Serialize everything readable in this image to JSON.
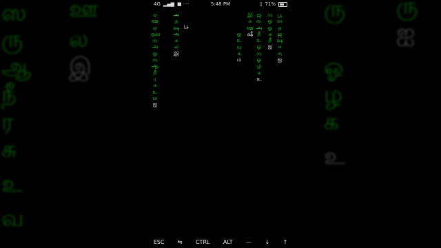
{
  "status_bar": {
    "network": "4G",
    "time": "5:48 PM",
    "battery": "71%",
    "battery_level": 0.71
  },
  "matrix_columns": [
    {
      "glyphs": [
        "ஏ",
        "ஊ",
        "ஏ",
        "ஔ",
        "ரு",
        "அ",
        "ஓ",
        "ரு",
        "ஆ",
        "நீ",
        "ர",
        "சு",
        "உ",
        "ள",
        "ஐ"
      ],
      "head_index": 14
    },
    {
      "glyphs": [
        "அ",
        "த",
        "ஷ",
        "அ",
        "க",
        "ல",
        "இ"
      ],
      "head_index": 6
    },
    {
      "glyphs": [
        "பூ"
      ],
      "head_index": 0
    },
    {
      "glyphs": [
        "ஓ",
        "உ",
        "ரு",
        "க",
        "ம"
      ],
      "head_index": 4
    },
    {
      "glyphs": [
        "இ",
        "சு",
        "ஊ",
        "ஷீ"
      ],
      "head_index": 3
    },
    {
      "glyphs": [
        "ஜ",
        "வ",
        "அ",
        "நீ",
        "உ",
        "ஓ",
        "ரு",
        "ஓ",
        "ழ",
        "க",
        "உ"
      ],
      "head_index": 10
    },
    {
      "glyphs": [
        "ரு",
        "ஓ",
        "ஓ",
        "க",
        "நீ",
        "ஐ"
      ],
      "head_index": 5
    },
    {
      "glyphs": [
        "பூ",
        "ள",
        "த",
        "ஜ",
        "ஷ",
        "க",
        "ரு",
        "ஐ"
      ],
      "head_index": 7
    }
  ],
  "background_glyphs": [
    {
      "glyph": "ஸ",
      "tone": "green"
    },
    {
      "glyph": "ல",
      "tone": "green"
    },
    {
      "glyph": "ரு",
      "tone": "green"
    },
    {
      "glyph": "ஆ",
      "tone": "green"
    },
    {
      "glyph": "நீ",
      "tone": "green"
    },
    {
      "glyph": "ர",
      "tone": "green"
    },
    {
      "glyph": "சு",
      "tone": "green"
    },
    {
      "glyph": "உ",
      "tone": "green"
    },
    {
      "glyph": "வ",
      "tone": "green"
    },
    {
      "glyph": "ஊ",
      "tone": "green"
    },
    {
      "glyph": "ல",
      "tone": "white"
    },
    {
      "glyph": "இ",
      "tone": "white"
    },
    {
      "glyph": "ரு",
      "tone": "green"
    },
    {
      "glyph": "ஐ",
      "tone": "white"
    },
    {
      "glyph": "ரு",
      "tone": "green"
    },
    {
      "glyph": "ஓ",
      "tone": "green"
    },
    {
      "glyph": "ழ",
      "tone": "green"
    },
    {
      "glyph": "க",
      "tone": "green"
    },
    {
      "glyph": "உ",
      "tone": "white"
    }
  ],
  "keyboard_bar": {
    "keys": [
      "ESC",
      "⇆",
      "CTRL",
      "ALT",
      "—",
      "↓",
      "↑"
    ]
  },
  "colors": {
    "matrix_green": "#20d020",
    "head_white": "#ffffff",
    "background": "#000000"
  }
}
